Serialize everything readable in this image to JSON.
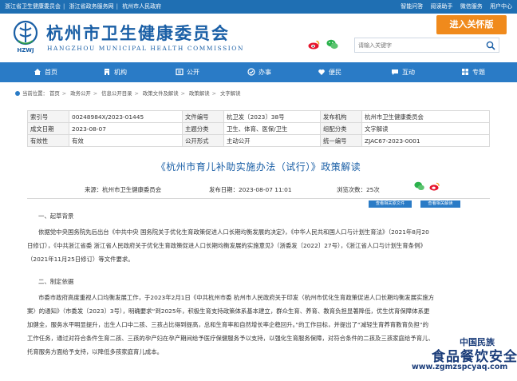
{
  "topbar": {
    "links": [
      "浙江省卫生健康委员会",
      "浙江省政务服务网",
      "杭州市人民政府"
    ],
    "right": [
      "智能问答",
      "阅读助手",
      "微信服务",
      "用户中心"
    ]
  },
  "header": {
    "emblem_text": "HZWJ",
    "title": "杭州市卫生健康委员会",
    "subtitle": "HANGZHOU MUNICIPAL HEALTH COMMISSION",
    "care_button": "进入关怀版",
    "search_placeholder": "请输入关键字"
  },
  "nav": [
    {
      "label": "首页",
      "icon": "home-icon"
    },
    {
      "label": "机构",
      "icon": "building-icon"
    },
    {
      "label": "公开",
      "icon": "open-icon"
    },
    {
      "label": "办事",
      "icon": "service-icon"
    },
    {
      "label": "便民",
      "icon": "convenience-icon"
    },
    {
      "label": "互动",
      "icon": "interact-icon"
    },
    {
      "label": "专题",
      "icon": "topic-icon"
    }
  ],
  "breadcrumb": {
    "prefix": "当前位置：",
    "items": [
      "首页",
      "政务公开",
      "信息公开目录",
      "政策文件及解读",
      "政策解读",
      "文字解读"
    ]
  },
  "meta": [
    {
      "k1": "索引号",
      "v1": "00248984X/2023-01445",
      "k2": "文件编号",
      "v2": "杭卫发〔2023〕38号",
      "k3": "发布机构",
      "v3": "杭州市卫生健康委员会"
    },
    {
      "k1": "成文日期",
      "v1": "2023-08-07",
      "k2": "主题分类",
      "v2": "卫生、体育、医保/卫生",
      "k3": "组配分类",
      "v3": "文字解读"
    },
    {
      "k1": "有效性",
      "v1": "有效",
      "k2": "公开形式",
      "v2": "主动公开",
      "k3": "统一编号",
      "v3": "ZJAC67-2023-0001"
    }
  ],
  "doc": {
    "title": "《杭州市育儿补助实施办法（试行）》政策解读",
    "source": "来源：杭州市卫生健康委员会",
    "date": "发布日期：2023-08-07 11:01",
    "views": "浏览次数：25次",
    "btn_related": "查看相关原文件",
    "btn_interpret": "查看相关解读"
  },
  "body": {
    "h1": "一、起草背景",
    "p1": [
      "依据党中央国务院先后出台《中共中央 国务院关于优化生育政策促进人口长期均衡发展的决定》，《中华人民共和国人口与计划生育法》（2021年8月20",
      "日修订），《中共浙江省委 浙江省人民政府关于优化生育政策促进人口长期均衡发展的实施意见》（浙委发〔2022〕27号），《浙江省人口与计划生育条例》",
      "（2021年11月25日修订）等文件要求。"
    ],
    "h2": "二、制定依据",
    "p2": [
      "市委市政府高度重视人口均衡发展工作，于2023年2月1日《中共杭州市委 杭州市人民政府关于印发〈杭州市优化生育政策促进人口长期均衡发展实施方",
      "案〉的通知》（市委发〔2023〕3号），明确要求“到2025年，积极生育支持政策体系基本建立，群众生育、养育、教育负担显著降低，优生优育保障体系更",
      "加健全，服务水平明显提升，出生人口中二孩、三孩占比得到提高，总和生育率和自然增长率企稳回升。”的工作目标，并提出了“减轻生育养育教育负担”的",
      "工作任务，通过对符合条件生育二孩、三孩的孕产妇在孕产期间给予医疗保健服务予以支持，以强化生育服务保障，对符合条件的二孩及三孩家庭给予育儿、",
      "托育服务方面给予支持，以降低多孩家庭育儿成本。"
    ]
  },
  "watermark": {
    "line1": "中国民族",
    "line2": "食品餐饮安全网",
    "line3": "www.zgmzspcyaq.com"
  },
  "colors": {
    "topbar": "#1f6fb3",
    "nav": "#2a7bc6",
    "title_blue": "#1a5fa6",
    "care_orange": "#f08a1c"
  }
}
